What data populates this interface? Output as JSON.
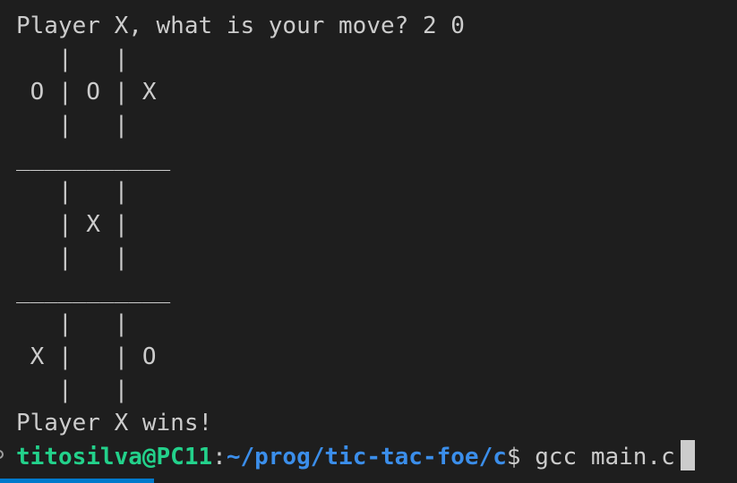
{
  "terminal": {
    "lines": [
      "Player X, what is your move? 2 0",
      "   |   |",
      " O | O | X",
      "   |   |",
      "___________",
      "   |   |",
      "   | X |",
      "   |   |",
      "___________",
      "   |   |",
      " X |   | O",
      "   |   |",
      "Player X wins!"
    ],
    "prompt": {
      "user_host": "titosilva@PC11",
      "separator": ":",
      "path": "~/prog/tic-tac-foe/c",
      "dollar": "$",
      "command": " gcc main.c"
    }
  },
  "colors": {
    "background": "#1e1e1e",
    "foreground": "#cccccc",
    "user_host": "#23d18b",
    "path": "#3b8eea",
    "accent": "#007acc"
  },
  "icons": [
    "circle-decoration-icon"
  ]
}
